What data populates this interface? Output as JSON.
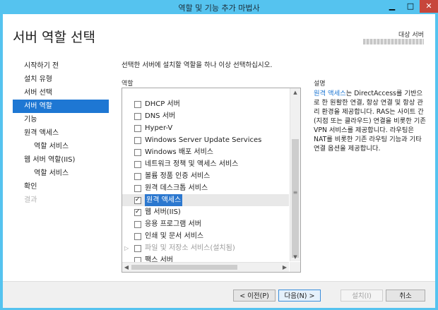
{
  "window": {
    "title": "역할 및 기능 추가 마법사",
    "min": "▁",
    "max": "□",
    "close": "✕"
  },
  "header": {
    "page_title": "서버 역할 선택",
    "dest_label": "대상 서버"
  },
  "nav": {
    "items": [
      {
        "label": "시작하기 전",
        "state": "normal"
      },
      {
        "label": "설치 유형",
        "state": "normal"
      },
      {
        "label": "서버 선택",
        "state": "normal"
      },
      {
        "label": "서버 역할",
        "state": "active"
      },
      {
        "label": "기능",
        "state": "normal"
      },
      {
        "label": "원격 액세스",
        "state": "normal"
      },
      {
        "label": "역할 서비스",
        "state": "sub"
      },
      {
        "label": "웹 서버 역할(IIS)",
        "state": "normal"
      },
      {
        "label": "역할 서비스",
        "state": "sub"
      },
      {
        "label": "확인",
        "state": "normal"
      },
      {
        "label": "결과",
        "state": "disabled"
      }
    ]
  },
  "main": {
    "instruction": "선택한 서버에 설치할 역할을 하나 이상 선택하십시오.",
    "roles_label": "역할",
    "roles": [
      {
        "label": "DHCP 서버",
        "checked": false
      },
      {
        "label": "DNS 서버",
        "checked": false
      },
      {
        "label": "Hyper-V",
        "checked": false
      },
      {
        "label": "Windows Server Update Services",
        "checked": false
      },
      {
        "label": "Windows 배포 서비스",
        "checked": false
      },
      {
        "label": "네트워크 정책 및 액세스 서비스",
        "checked": false
      },
      {
        "label": "볼륨 정품 인증 서비스",
        "checked": false
      },
      {
        "label": "원격 데스크톱 서비스",
        "checked": false
      },
      {
        "label": "원격 액세스",
        "checked": true,
        "selected": true
      },
      {
        "label": "웹 서버(IIS)",
        "checked": true
      },
      {
        "label": "응용 프로그램 서버",
        "checked": false
      },
      {
        "label": "인쇄 및 문서 서비스",
        "checked": false
      },
      {
        "label": "파일 및 저장소 서비스(설치됨)",
        "checked": false,
        "dim": true,
        "expandable": true
      },
      {
        "label": "팩스 서버",
        "checked": false
      }
    ]
  },
  "description": {
    "label": "설명",
    "link_text": "원격 액세스",
    "text": "는 DirectAccess를 기반으로 한 원활한 연결, 항상 연결 및 항상 관리 환경을 제공합니다. RAS는 사이트 간(지점 또는 클라우드) 연결을 비롯한 기존 VPN 서비스를 제공합니다. 라우팅은 NAT를 비롯한 기존 라우팅 기능과 기타 연결 옵션을 제공합니다."
  },
  "footer": {
    "prev": "< 이전(P)",
    "next": "다음(N) >",
    "install": "설치(I)",
    "cancel": "취소"
  }
}
